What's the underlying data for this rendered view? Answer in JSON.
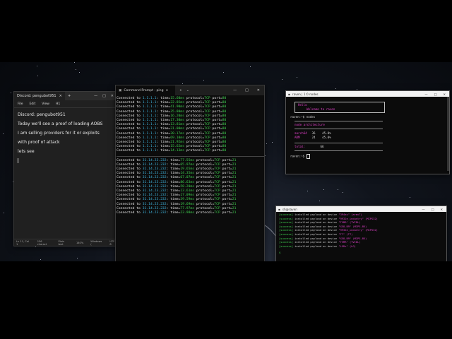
{
  "notepad": {
    "tab_title": "Discord: pengubot951",
    "tab_close": "×",
    "new_tab": "+",
    "window_controls": [
      "—",
      "□",
      "✕"
    ],
    "menu": [
      "File",
      "Edit",
      "View",
      "H1"
    ],
    "lines": [
      "Discord: pengubot951",
      "Today we'll see a proof of loading AOBS",
      "I am selling providers for it or exploits",
      "with proof of attack",
      "lets see"
    ],
    "status": [
      "Ln 11, Col 1",
      "156 charact",
      "Plain text",
      "140%",
      "Windows (",
      "UTF-8"
    ]
  },
  "cmd": {
    "tab_title": "Command Prompt - ping",
    "tab_close": "×",
    "new_tab": "+",
    "dropdown": "⌄",
    "window_controls": [
      "—",
      "□",
      "✕"
    ],
    "prefix": "Connected to",
    "block1_host": "1.1.1.1",
    "block1_port": "80",
    "block1_times": [
      "15.60ms",
      "22.85ms",
      "41.90ms",
      "35.80ms",
      "16.20ms",
      "17.30ms",
      "13.81ms",
      "31.00ms",
      "20.17ms",
      "69.10ms",
      "21.92ms",
      "15.62ms",
      "14.13ms"
    ],
    "block2_host": "31.14.23.232",
    "block2_port": "21",
    "block2_times": [
      "77.55ms",
      "65.97ms",
      "19.65ms",
      "14.35ms",
      "67.07ms",
      "86.63ms",
      "58.20ms",
      "13.61ms",
      "17.09ms",
      "39.59ms",
      "19.69ms",
      "77.97ms",
      "23.98ms"
    ]
  },
  "raven": {
    "title": "raven | 1:0 nodes",
    "window_controls": [
      "—",
      "□",
      "✕"
    ],
    "banner": [
      "Hello",
      "Welcome to raven"
    ],
    "cmd1": "raven:~$ nodes",
    "section": "node architecture",
    "rows": [
      {
        "arch": "aarch64",
        "count": "36",
        "pct": "45.0%"
      },
      {
        "arch": "ARM",
        "count": "24",
        "pct": "45.0%"
      }
    ],
    "total_label": "total:",
    "total_value": "66",
    "prompt2": "raven:~$ "
  },
  "sh2": {
    "title": "sh@raven",
    "window_controls": [
      "—",
      "□",
      "✕"
    ],
    "lines": [
      {
        "tag": "[success]",
        "dev": "\"394as\"",
        "arch": "(armv7)"
      },
      {
        "tag": "[success]",
        "dev": "\"9932e_industry\"",
        "arch": "(MIPS32)"
      },
      {
        "tag": "[success]",
        "dev": "\"TVMR\"",
        "arch": "(TVIDL)"
      },
      {
        "tag": "[success]",
        "dev": "\"X58-B9\"",
        "arch": "(MIPS-B5)"
      },
      {
        "tag": "[success]",
        "dev": "\"9932e_industry\"",
        "arch": "(MIPS32)"
      },
      {
        "tag": "[success]",
        "dev": "\"T7\"",
        "arch": "(T7)"
      },
      {
        "tag": "[success]",
        "dev": "\"X58-B9\"",
        "arch": "(MIPS-B5)"
      },
      {
        "tag": "[success]",
        "dev": "\"TVMR\"",
        "arch": "(TVIDL)"
      },
      {
        "tag": "[success]",
        "dev": "\"LGDv\"",
        "arch": "(LG)"
      }
    ],
    "middle": " installed payload on device ",
    "prompt": "$"
  }
}
